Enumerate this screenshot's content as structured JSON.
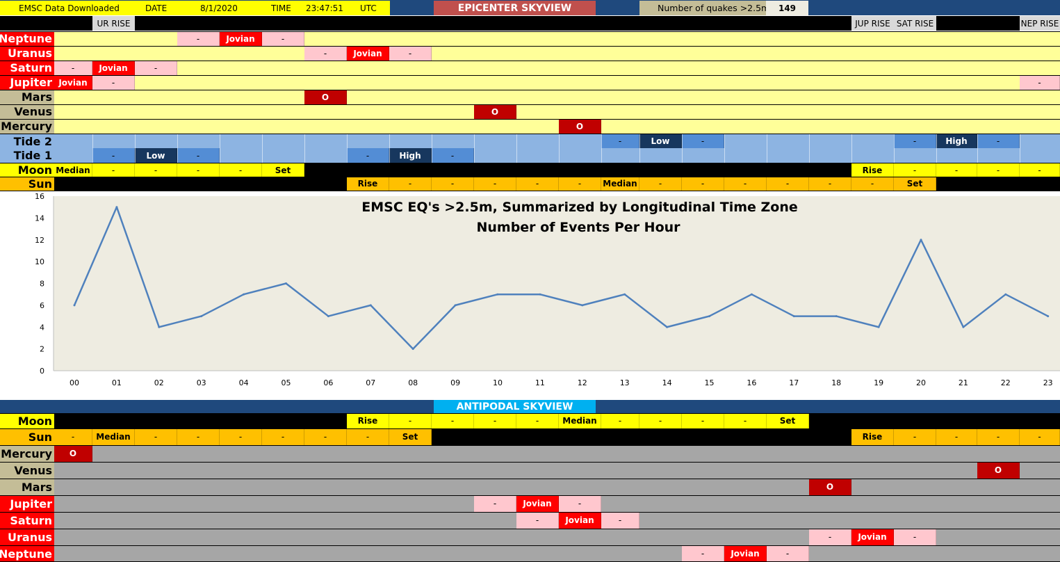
{
  "header": {
    "downloaded_label": "EMSC Data Downloaded",
    "date_label": "DATE",
    "date_value": "8/1/2020",
    "time_label": "TIME",
    "time_value": "23:47:51",
    "tz_label": "UTC",
    "epicenter_title": "EPICENTER SKYVIEW",
    "quakes_label": "Number of quakes >2.5m",
    "quakes_value": "149"
  },
  "rise_labels": [
    "UR RISE",
    "JUP RISE",
    "SAT RISE",
    "NEP RISE"
  ],
  "epicenter_rows": [
    {
      "label": "Neptune",
      "style": "planet"
    },
    {
      "label": "Uranus",
      "style": "planet"
    },
    {
      "label": "Saturn",
      "style": "planet"
    },
    {
      "label": "Jupiter",
      "style": "planet"
    },
    {
      "label": "Mars",
      "style": "rock"
    },
    {
      "label": "Venus",
      "style": "rock"
    },
    {
      "label": "Mercury",
      "style": "rock"
    },
    {
      "label": "Tide 2",
      "style": "tide"
    },
    {
      "label": "Tide 1",
      "style": "tide"
    },
    {
      "label": "Moon",
      "style": "moon"
    },
    {
      "label": "Sun",
      "style": "sun"
    }
  ],
  "cell_texts": {
    "jovian": "Jovian",
    "dash": "-",
    "conj": "O",
    "low": "Low",
    "high": "High",
    "median": "Median",
    "rise": "Rise",
    "set": "Set"
  },
  "antipodal": {
    "title": "ANTIPODAL SKYVIEW",
    "rows": [
      {
        "label": "Moon",
        "style": "moon"
      },
      {
        "label": "Sun",
        "style": "sun"
      },
      {
        "label": "Mercury",
        "style": "rock"
      },
      {
        "label": "Venus",
        "style": "rock"
      },
      {
        "label": "Mars",
        "style": "rock"
      },
      {
        "label": "Jupiter",
        "style": "planet"
      },
      {
        "label": "Saturn",
        "style": "planet"
      },
      {
        "label": "Uranus",
        "style": "planet"
      },
      {
        "label": "Neptune",
        "style": "planet"
      }
    ]
  },
  "colors": {
    "navy": "#1F497D",
    "header_red": "#C0504D",
    "tan": "#C4BD97",
    "yellow": "#FFFF00",
    "light_yellow": "#FFFF99",
    "pink": "#FFC7CE",
    "red": "#FF0000",
    "dark_red": "#C00000",
    "tide_light": "#8DB4E2",
    "tide_mid": "#538DD5",
    "tide_dark": "#17375E",
    "orange": "#FFC000",
    "gray": "#A6A6A6",
    "cyan": "#00B0F0",
    "plot_bg": "#EEECE1",
    "line": "#4F81BD"
  },
  "chart_data": {
    "type": "line",
    "title": "EMSC EQ's >2.5m, Summarized by Longitudinal Time Zone",
    "subtitle": "Number of Events Per Hour",
    "categories": [
      "00",
      "01",
      "02",
      "03",
      "04",
      "05",
      "06",
      "07",
      "08",
      "09",
      "10",
      "11",
      "12",
      "13",
      "14",
      "15",
      "16",
      "17",
      "18",
      "19",
      "20",
      "21",
      "22",
      "23"
    ],
    "values": [
      6,
      15,
      4,
      5,
      7,
      8,
      5,
      6,
      2,
      6,
      7,
      7,
      6,
      7,
      4,
      5,
      7,
      5,
      5,
      4,
      12,
      4,
      7,
      5
    ],
    "ylim": [
      0,
      16
    ],
    "yticks": [
      "0",
      "2",
      "4",
      "6",
      "8",
      "10",
      "12",
      "14",
      "16"
    ],
    "grid": false,
    "legend": "none"
  }
}
